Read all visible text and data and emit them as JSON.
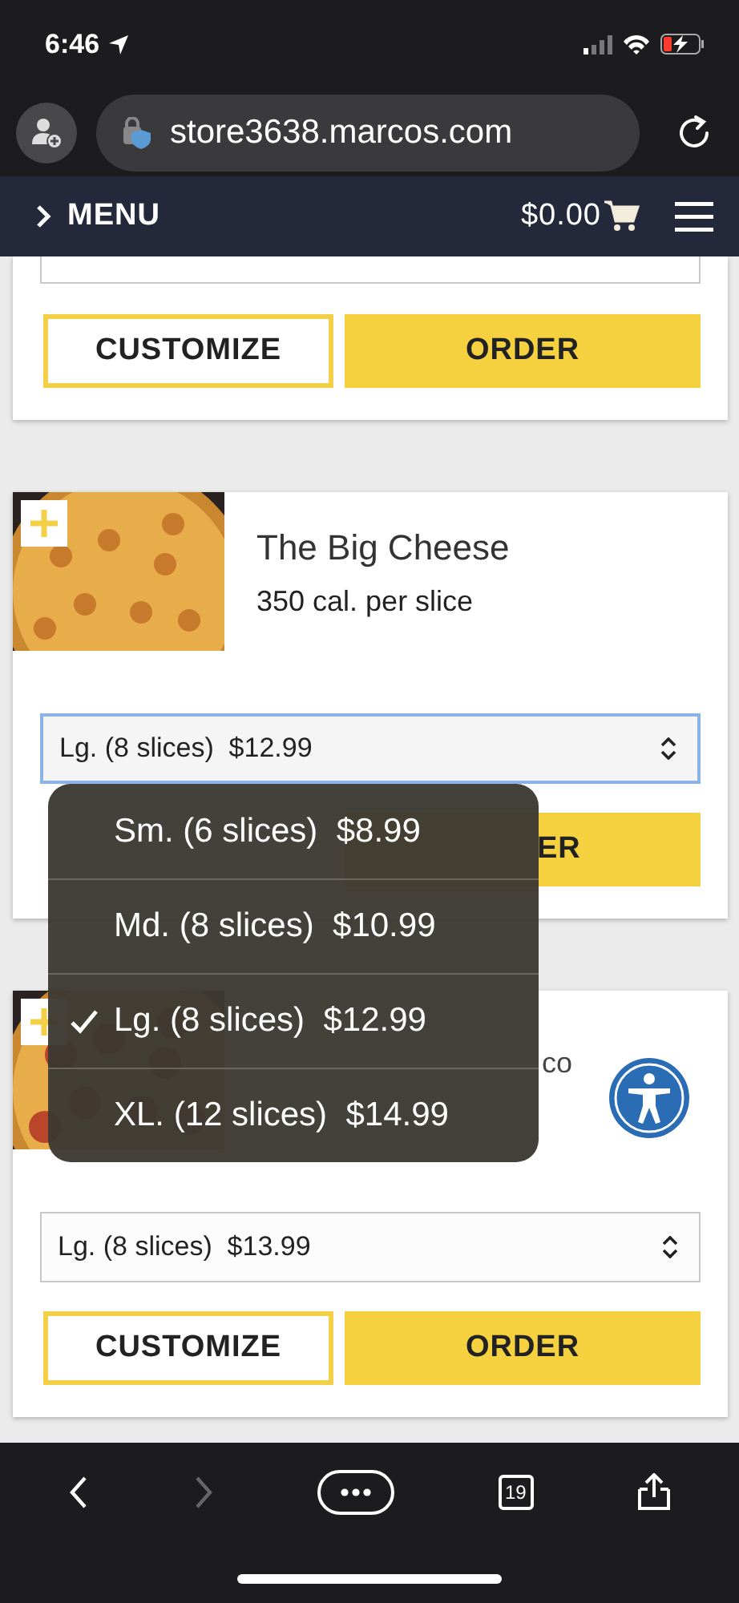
{
  "status_bar": {
    "time": "6:46"
  },
  "browser": {
    "url": "store3638.marcos.com"
  },
  "nav": {
    "menu_label": "MENU",
    "cart_total": "$0.00"
  },
  "cards": [
    {
      "kind": "cut_top",
      "buttons": [
        {
          "label": "CUSTOMIZE",
          "kind": "outline"
        },
        {
          "label": "ORDER",
          "kind": "fill"
        }
      ]
    },
    {
      "kind": "full",
      "title": "The Big Cheese",
      "calories": "350 cal. per slice",
      "select": {
        "value": "Lg. (8 slices)  $12.99",
        "focused": true
      },
      "buttons": [
        {
          "label": "ER",
          "kind": "fill_covered"
        }
      ]
    },
    {
      "kind": "covered",
      "title": "co",
      "select": {
        "value": "Lg. (8 slices)  $13.99",
        "focused": false
      },
      "buttons": [
        {
          "label": "CUSTOMIZE",
          "kind": "outline"
        },
        {
          "label": "ORDER",
          "kind": "fill"
        }
      ]
    }
  ],
  "popover": {
    "options": [
      {
        "label": "Sm. (6 slices)  $8.99",
        "selected": false
      },
      {
        "label": "Md. (8 slices)  $10.99",
        "selected": false
      },
      {
        "label": "Lg. (8 slices)  $12.99",
        "selected": true
      },
      {
        "label": "XL. (12 slices)  $14.99",
        "selected": false
      }
    ]
  },
  "toolbar": {
    "tabs_count": "19",
    "forward_disabled": true
  }
}
